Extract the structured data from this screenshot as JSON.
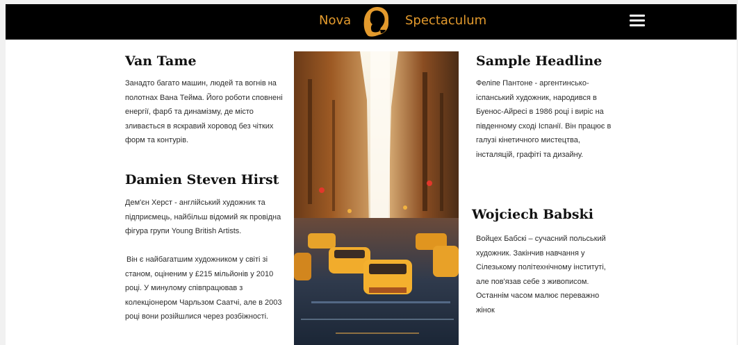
{
  "header": {
    "brand_left": "Nova",
    "brand_right": "Spectaculum",
    "logo_icon": "face-profile-logo-icon",
    "menu_icon": "hamburger-menu-icon",
    "background": "#000000",
    "accent": "#e39a2d"
  },
  "articles": {
    "van_tame": {
      "title": "Van Tame",
      "text": "Занадто багато машин, людей та вогнів на полотнах Вана Тейма. Його роботи сповнені енергії, фарб та динамізму, де місто зливається в яскравий хоровод без чітких форм та контурів."
    },
    "hirst": {
      "title": "Damien Steven Hirst",
      "text1": "Дем'єн Херст - англійський художник та підприємець, найбільш відомий як провідна фігура групи Young British Artists.",
      "text2": "Він є найбагатшим художником у світі зі станом, оціненим у £215 мільйонів у 2010 році. У минулому співпрацював з колекціонером Чарльзом Саатчі, але в 2003 році вони розійшлися через розбіжності."
    },
    "sample": {
      "title": "Sample Headline",
      "text": "Феліпе Пантоне - аргентинсько-іспанський художник, народився в Буенос-Айресі в 1986 році і виріс на південному сході Іспанії. Він працює в галузі кінетичного мистецтва, інсталяцій, графіті та дизайну."
    },
    "babski": {
      "title": "Wojciech Babski",
      "text": "Войцех Бабскі  – сучасний польський художник. Закінчив навчання у Сілезькому політехнічному інституті, але пов'язав себе з живописом. Останнім часом малює переважно жінок"
    }
  },
  "image": {
    "subject": "painting-city-street-yellow-taxis"
  }
}
